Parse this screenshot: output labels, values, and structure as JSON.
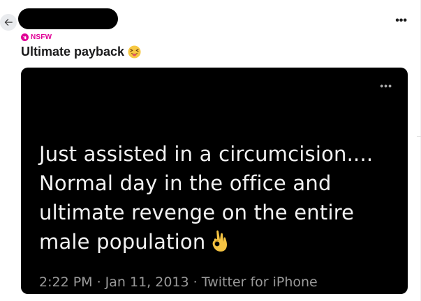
{
  "post": {
    "nsfw_label": "NSFW",
    "title": "Ultimate payback",
    "title_emoji": "face-with-tongue-squinting",
    "menu_label": "•••"
  },
  "media": {
    "menu_label": "•••",
    "tweet_text": "Just assisted in a circumcision.... Normal day in the office and ultimate revenge on the entire male population",
    "tweet_emoji": "ok-hand",
    "meta": "2:22 PM · Jan 11, 2013 · Twitter for iPhone"
  },
  "colors": {
    "nsfw": "#e00096",
    "media_background": "#000000",
    "tweet_text": "#f2f2f2",
    "meta_text": "#9a9a9a"
  }
}
